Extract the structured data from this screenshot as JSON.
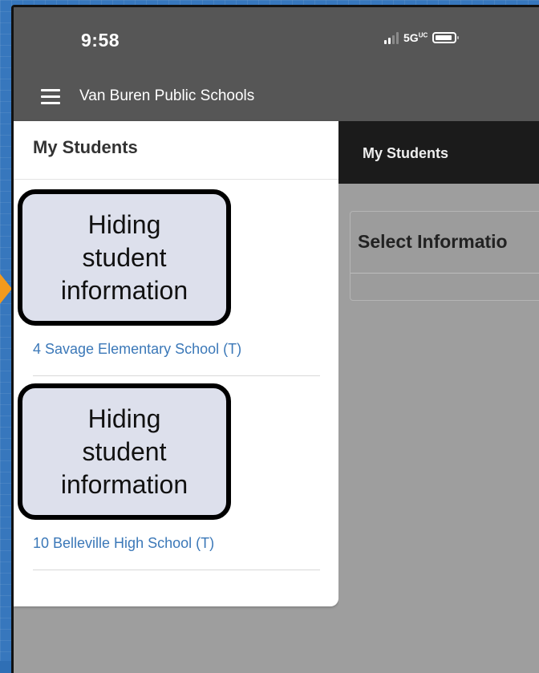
{
  "status_bar": {
    "time": "9:58",
    "network": "5G",
    "network_sup": "UC"
  },
  "header": {
    "app_title": "Van Buren Public Schools"
  },
  "drawer": {
    "title": "My Students",
    "students": [
      {
        "school": "4  Savage Elementary School (T)",
        "overlay_lines": [
          "Hiding",
          "student",
          "information"
        ]
      },
      {
        "school": "10  Belleville High School (T)",
        "overlay_lines": [
          "Hiding",
          "student",
          "information"
        ]
      }
    ]
  },
  "main": {
    "tab_label": "My Students",
    "panel_title": "Select Informatio"
  },
  "colors": {
    "accent_link": "#3b78b8",
    "header_bg": "#565656",
    "overlay_bg": "#dde0ec",
    "arrow": "#f39a1d"
  }
}
